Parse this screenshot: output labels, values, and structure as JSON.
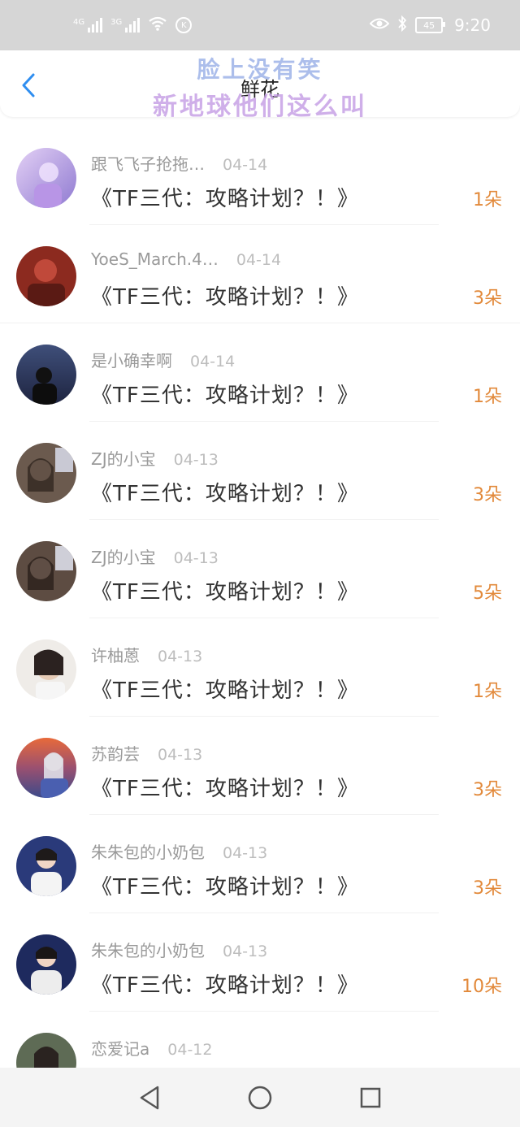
{
  "status_bar": {
    "network_1": "4G",
    "network_2": "3G",
    "vpn_badge": "K",
    "battery": "45",
    "time": "9:20",
    "icons": [
      "signal-icon",
      "signal-icon",
      "wifi-icon",
      "k-badge-icon",
      "eye-icon",
      "bluetooth-icon",
      "battery-icon"
    ]
  },
  "header": {
    "title": "鲜花",
    "overlay_line_1": "脸上没有笑",
    "overlay_line_2": "新地球他们这么叫",
    "back_icon": "chevron-left-icon",
    "accent": "#2f8ef0"
  },
  "accent_colors": {
    "count": "#e2893a",
    "name": "#9a9a9a",
    "date": "#bdbdbd"
  },
  "items": [
    {
      "name": "跟飞飞子抢拖…",
      "date": "04-14",
      "title": "《TF三代：攻略计划？！》",
      "count": "1朵"
    },
    {
      "name": "YoeS_March.4…",
      "date": "04-14",
      "title": "《TF三代：攻略计划？！》",
      "count": "3朵"
    },
    {
      "name": "是小确幸啊",
      "date": "04-14",
      "title": "《TF三代：攻略计划？！》",
      "count": "1朵"
    },
    {
      "name": "ZJ的小宝",
      "date": "04-13",
      "title": "《TF三代：攻略计划？！》",
      "count": "3朵"
    },
    {
      "name": "ZJ的小宝",
      "date": "04-13",
      "title": "《TF三代：攻略计划？！》",
      "count": "5朵"
    },
    {
      "name": "许柚蒽",
      "date": "04-13",
      "title": "《TF三代：攻略计划？！》",
      "count": "1朵"
    },
    {
      "name": "苏韵芸",
      "date": "04-13",
      "title": "《TF三代：攻略计划？！》",
      "count": "3朵"
    },
    {
      "name": "朱朱包的小奶包",
      "date": "04-13",
      "title": "《TF三代：攻略计划？！》",
      "count": "3朵"
    },
    {
      "name": "朱朱包的小奶包",
      "date": "04-13",
      "title": "《TF三代：攻略计划？！》",
      "count": "10朵"
    },
    {
      "name": "恋爱记a",
      "date": "04-12",
      "title": "",
      "count": ""
    }
  ],
  "nav": {
    "back_icon": "triangle-back-icon",
    "home_icon": "circle-home-icon",
    "recents_icon": "square-recents-icon"
  }
}
